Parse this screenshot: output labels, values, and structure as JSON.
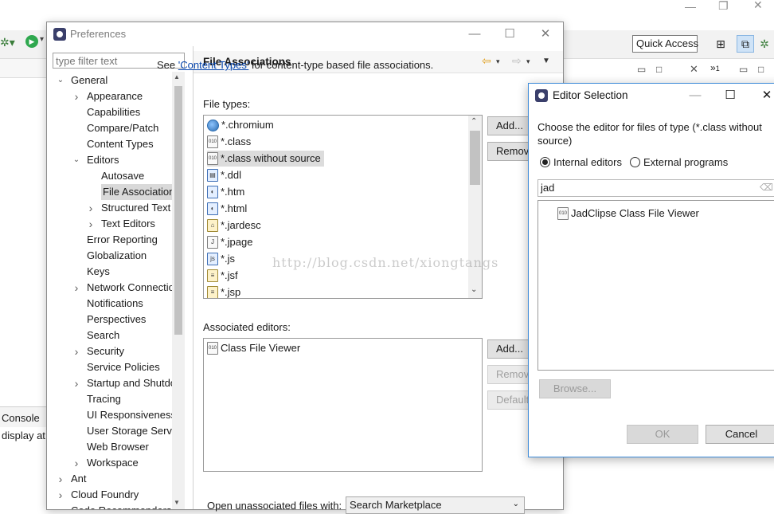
{
  "workbench": {
    "quick_access": "Quick Access",
    "console_tab": "Console",
    "console_text": "display at",
    "view_menu_count": "1"
  },
  "preferences": {
    "title": "Preferences",
    "filter_placeholder": "type filter text",
    "tree": [
      {
        "label": "General",
        "level": 0,
        "expander": "open"
      },
      {
        "label": "Appearance",
        "level": 1,
        "expander": "closed"
      },
      {
        "label": "Capabilities",
        "level": 1,
        "expander": "none"
      },
      {
        "label": "Compare/Patch",
        "level": 1,
        "expander": "none"
      },
      {
        "label": "Content Types",
        "level": 1,
        "expander": "none"
      },
      {
        "label": "Editors",
        "level": 1,
        "expander": "open"
      },
      {
        "label": "Autosave",
        "level": 2,
        "expander": "none"
      },
      {
        "label": "File Associations",
        "level": 2,
        "expander": "none",
        "selected": true
      },
      {
        "label": "Structured Text",
        "level": 2,
        "expander": "closed"
      },
      {
        "label": "Text Editors",
        "level": 2,
        "expander": "closed"
      },
      {
        "label": "Error Reporting",
        "level": 1,
        "expander": "none"
      },
      {
        "label": "Globalization",
        "level": 1,
        "expander": "none"
      },
      {
        "label": "Keys",
        "level": 1,
        "expander": "none"
      },
      {
        "label": "Network Connections",
        "level": 1,
        "expander": "closed"
      },
      {
        "label": "Notifications",
        "level": 1,
        "expander": "none"
      },
      {
        "label": "Perspectives",
        "level": 1,
        "expander": "none"
      },
      {
        "label": "Search",
        "level": 1,
        "expander": "none"
      },
      {
        "label": "Security",
        "level": 1,
        "expander": "closed"
      },
      {
        "label": "Service Policies",
        "level": 1,
        "expander": "none"
      },
      {
        "label": "Startup and Shutdown",
        "level": 1,
        "expander": "closed"
      },
      {
        "label": "Tracing",
        "level": 1,
        "expander": "none"
      },
      {
        "label": "UI Responsiveness",
        "level": 1,
        "expander": "none"
      },
      {
        "label": "User Storage Service",
        "level": 1,
        "expander": "none"
      },
      {
        "label": "Web Browser",
        "level": 1,
        "expander": "none"
      },
      {
        "label": "Workspace",
        "level": 1,
        "expander": "closed"
      },
      {
        "label": "Ant",
        "level": 0,
        "expander": "closed"
      },
      {
        "label": "Cloud Foundry",
        "level": 0,
        "expander": "closed"
      },
      {
        "label": "Code Recommenders",
        "level": 0,
        "expander": "closed"
      }
    ],
    "page_title": "File Associations",
    "see_prefix": "See ",
    "see_link": "'Content Types'",
    "see_suffix": " for content-type based file associations.",
    "file_types_label": "File types:",
    "file_types": [
      {
        "name": "*.chromium",
        "icon": "globe"
      },
      {
        "name": "*.class",
        "icon": "class-file"
      },
      {
        "name": "*.class without source",
        "icon": "class-file",
        "selected": true
      },
      {
        "name": "*.ddl",
        "icon": "ddl-file"
      },
      {
        "name": "*.htm",
        "icon": "html-file"
      },
      {
        "name": "*.html",
        "icon": "html-file"
      },
      {
        "name": "*.jardesc",
        "icon": "jar-file"
      },
      {
        "name": "*.jpage",
        "icon": "jpage-file"
      },
      {
        "name": "*.js",
        "icon": "js-file"
      },
      {
        "name": "*.jsf",
        "icon": "jsf-file"
      },
      {
        "name": "*.jsp",
        "icon": "jsp-file"
      }
    ],
    "add_label": "Add...",
    "remove_label": "Remove",
    "default_label": "Default",
    "associated_label": "Associated editors:",
    "associated_editors": [
      {
        "name": "Class File Viewer",
        "icon": "class-file"
      }
    ],
    "open_unassociated_label": "Open unassociated files with:",
    "open_unassociated_value": "Search Marketplace"
  },
  "editor_selection": {
    "title": "Editor Selection",
    "prompt": "Choose the editor for files of type (*.class without source)",
    "radio_internal": "Internal editors",
    "radio_external": "External programs",
    "search_value": "jad",
    "editors": [
      {
        "name": "JadClipse Class File Viewer",
        "icon": "class-file"
      }
    ],
    "browse_label": "Browse...",
    "ok_label": "OK",
    "cancel_label": "Cancel"
  },
  "watermark": "http://blog.csdn.net/xiongtangs"
}
